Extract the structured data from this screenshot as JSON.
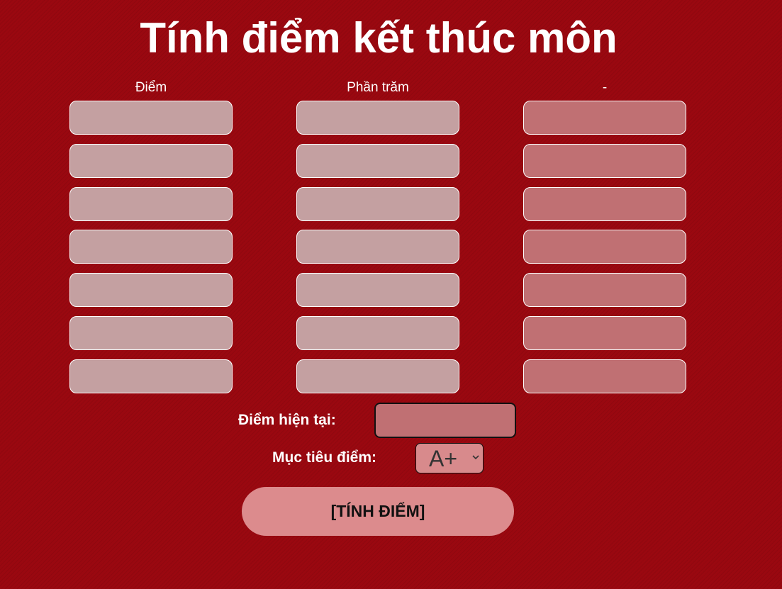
{
  "title": "Tính điểm kết thúc môn",
  "columns": {
    "score_header": "Điểm",
    "percent_header": "Phần trăm",
    "third_header": "-"
  },
  "rows": [
    {
      "score": "",
      "percent": "",
      "third": ""
    },
    {
      "score": "",
      "percent": "",
      "third": ""
    },
    {
      "score": "",
      "percent": "",
      "third": ""
    },
    {
      "score": "",
      "percent": "",
      "third": ""
    },
    {
      "score": "",
      "percent": "",
      "third": ""
    },
    {
      "score": "",
      "percent": "",
      "third": ""
    },
    {
      "score": "",
      "percent": "",
      "third": ""
    }
  ],
  "current": {
    "label": "Điểm hiện tại:",
    "value": ""
  },
  "target": {
    "label": "Mục tiêu điểm:",
    "selected": "A+"
  },
  "calculate_button": "[TÍNH ĐIỂM]",
  "colors": {
    "background": "#9a0810",
    "input_light": "#c4a0a1",
    "input_dark": "#c07073",
    "button": "#dc8b8d"
  },
  "icons": {
    "select_arrow": "chevron-down-icon"
  }
}
